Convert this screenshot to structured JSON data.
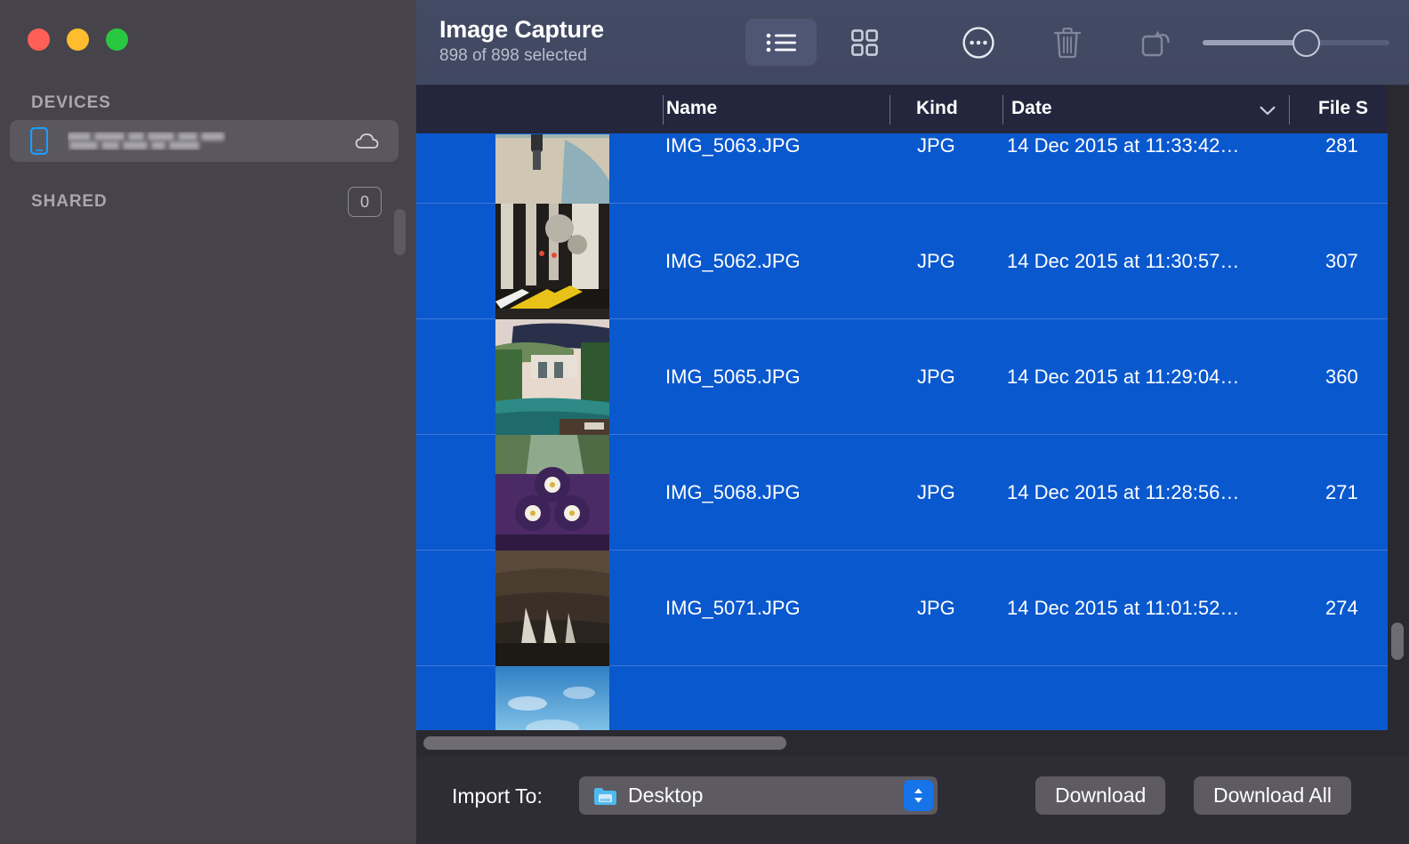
{
  "window": {
    "traffic_lights": [
      {
        "name": "close",
        "color": "#FF5F57"
      },
      {
        "name": "minimize",
        "color": "#FEBC2E"
      },
      {
        "name": "zoom",
        "color": "#28C840"
      }
    ]
  },
  "sidebar": {
    "sections": [
      {
        "title": "DEVICES",
        "items": [
          {
            "label": "",
            "redacted": true,
            "icon": "iphone-icon",
            "trailing_icon": "cloud-icon",
            "selected": true
          }
        ]
      },
      {
        "title": "SHARED",
        "badge": "0",
        "items": []
      }
    ]
  },
  "toolbar": {
    "title": "Image Capture",
    "subtitle": "898 of 898 selected",
    "view_modes": [
      {
        "name": "list-view",
        "icon": "list-icon",
        "active": true
      },
      {
        "name": "grid-view",
        "icon": "grid-icon",
        "active": false
      }
    ],
    "actions": [
      {
        "name": "more-options",
        "icon": "ellipsis-circle-icon",
        "enabled": true
      },
      {
        "name": "delete",
        "icon": "trash-icon",
        "enabled": false
      },
      {
        "name": "rotate",
        "icon": "rotate-icon",
        "enabled": false
      }
    ],
    "zoom_slider": {
      "name": "thumbnail-size-slider",
      "value_percent": 57
    }
  },
  "table": {
    "columns": [
      {
        "key": "thumbnail",
        "label": ""
      },
      {
        "key": "name",
        "label": "Name"
      },
      {
        "key": "kind",
        "label": "Kind"
      },
      {
        "key": "date",
        "label": "Date",
        "sorted": true,
        "sort_icon": "chevron-down-icon"
      },
      {
        "key": "size",
        "label": "File S"
      }
    ],
    "rows": [
      {
        "name": "IMG_5063.JPG",
        "kind": "JPG",
        "date": "14 Dec 2015 at 11:33:42…",
        "size": "281",
        "selected": true,
        "thumb": "beach-person"
      },
      {
        "name": "IMG_5062.JPG",
        "kind": "JPG",
        "date": "14 Dec 2015 at 11:30:57…",
        "size": "307",
        "selected": true,
        "thumb": "hotel-lobby"
      },
      {
        "name": "IMG_5065.JPG",
        "kind": "JPG",
        "date": "14 Dec 2015 at 11:29:04…",
        "size": "360",
        "selected": true,
        "thumb": "pool-villa"
      },
      {
        "name": "IMG_5068.JPG",
        "kind": "JPG",
        "date": "14 Dec 2015 at 11:28:56…",
        "size": "271",
        "selected": true,
        "thumb": "purple-flowers"
      },
      {
        "name": "IMG_5071.JPG",
        "kind": "JPG",
        "date": "14 Dec 2015 at 11:01:52…",
        "size": "274",
        "selected": true,
        "thumb": "tunnel-light"
      },
      {
        "name": "",
        "kind": "",
        "date": "",
        "size": "",
        "selected": true,
        "thumb": "sky-clouds"
      }
    ]
  },
  "bottom_bar": {
    "import_label": "Import To:",
    "import_destination": "Desktop",
    "import_icon": "folder-icon",
    "stepper_icon": "up-down-chevrons-icon",
    "download_label": "Download",
    "download_all_label": "Download All"
  },
  "colors": {
    "selection_blue": "#0A58CE",
    "sidebar_bg": "#46444A",
    "toolbar_bg": "#424963",
    "panel_bg": "#2B2930",
    "accent_blue": "#1673E8"
  }
}
